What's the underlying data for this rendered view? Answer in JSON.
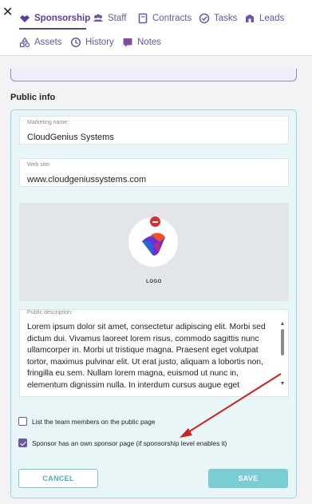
{
  "tabs": [
    {
      "label": "Sponsorship",
      "icon": "handshake-icon",
      "active": true
    },
    {
      "label": "Staff",
      "icon": "people-icon",
      "active": false
    },
    {
      "label": "Contracts",
      "icon": "book-icon",
      "active": false
    },
    {
      "label": "Tasks",
      "icon": "check-circle-icon",
      "active": false
    },
    {
      "label": "Leads",
      "icon": "leads-icon",
      "active": false
    },
    {
      "label": "Assets",
      "icon": "shapes-icon",
      "active": false
    },
    {
      "label": "History",
      "icon": "history-icon",
      "active": false
    },
    {
      "label": "Notes",
      "icon": "note-icon",
      "active": false
    }
  ],
  "section_title": "Public info",
  "marketing_name": {
    "label": "Marketing name:",
    "value": "CloudGenius Systems"
  },
  "website": {
    "label": "Web site:",
    "value": "www.cloudgeniussystems.com"
  },
  "logo": {
    "caption": "LOGO"
  },
  "description": {
    "label": "Public description:",
    "value": "Lorem ipsum dolor sit amet, consectetur adipiscing elit. Morbi sed dictum dui. Vivamus laoreet lorem risus, commodo sagittis nunc ullamcorper in. Morbi ut tristique magna. Praesent eget volutpat tortor, maximus pulvinar elit. Ut erat justo, aliquam a lobortis non, fringilla eu sem. Nullam lorem magna, euismod ut nunc in, elementum dignissim nulla. In interdum cursus augue eget"
  },
  "checkboxes": {
    "team_members": {
      "label": "List the team members on the public page",
      "checked": false
    },
    "own_page": {
      "label": "Sponsor has an own sponsor page (if sponsorship level enables it)",
      "checked": true
    }
  },
  "buttons": {
    "cancel": "CANCEL",
    "save": "SAVE"
  },
  "colors": {
    "accent": "#5b3f9e",
    "teal": "#79ced3",
    "annotation_arrow": "#d0211c"
  }
}
